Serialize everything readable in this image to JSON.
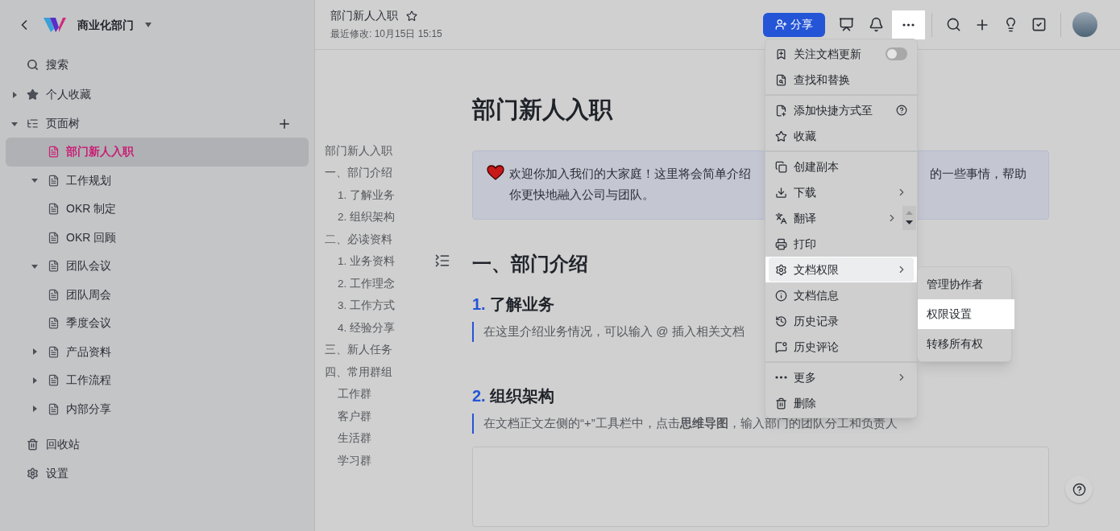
{
  "sidebar": {
    "workspace": "商业化部门",
    "nav": [
      {
        "label": "搜索"
      },
      {
        "label": "个人收藏",
        "expanded": false
      }
    ],
    "tree": {
      "label": "页面树",
      "expanded": true,
      "children": [
        {
          "label": "部门新人入职",
          "selected": true
        },
        {
          "label": "工作规划",
          "selected": false,
          "expanded": true,
          "children": [
            {
              "label": "OKR 制定",
              "selected": false
            },
            {
              "label": "OKR 回顾",
              "selected": false
            }
          ]
        },
        {
          "label": "团队会议",
          "selected": false,
          "expanded": true,
          "children": [
            {
              "label": "团队周会",
              "selected": false
            },
            {
              "label": "季度会议",
              "selected": false
            }
          ]
        },
        {
          "label": "产品资料",
          "selected": false,
          "expanded": false
        },
        {
          "label": "工作流程",
          "selected": false,
          "expanded": false
        },
        {
          "label": "内部分享",
          "selected": false,
          "expanded": false
        }
      ]
    },
    "footer": [
      {
        "label": "回收站"
      },
      {
        "label": "设置"
      }
    ]
  },
  "header": {
    "title": "部门新人入职",
    "modified": "最近修改: 10月15日 15:15",
    "share": "分享",
    "more_open": true
  },
  "outline": [
    {
      "label": "部门新人入职"
    },
    {
      "label": "一、部门介绍",
      "children": [
        {
          "label": "1. 了解业务"
        },
        {
          "label": "2. 组织架构"
        }
      ]
    },
    {
      "label": "二、必读资料",
      "children": [
        {
          "label": "1. 业务资料"
        },
        {
          "label": "2. 工作理念"
        },
        {
          "label": "3. 工作方式"
        },
        {
          "label": "4. 经验分享"
        }
      ]
    },
    {
      "label": "三、新人任务"
    },
    {
      "label": "四、常用群组",
      "children": [
        {
          "label": "工作群"
        },
        {
          "label": "客户群"
        },
        {
          "label": "生活群"
        },
        {
          "label": "学习群"
        }
      ]
    }
  ],
  "document": {
    "title": "部门新人入职",
    "callout": {
      "line_1_left": "欢迎你加入我们的大家庭！这里将会简单介绍",
      "line_1_right": "的一些事情，帮助",
      "line_2": "你更快地融入公司与团队。"
    },
    "section": "一、部门介绍",
    "subsections": [
      {
        "number": "1.",
        "title": "了解业务",
        "quote": "在这里介绍业务情况，可以输入 @ 插入相关文档"
      },
      {
        "number": "2.",
        "title": "组织架构",
        "quote": "在文档正文左侧的“+”工具栏中，点击**思维导图**，输入部门的团队分工和负责人"
      }
    ]
  },
  "menu": {
    "groups": [
      [
        {
          "label": "关注文档更新",
          "kind": "toggle",
          "on": false,
          "selected": false
        },
        {
          "label": "查找和替换",
          "kind": "plain",
          "selected": false
        }
      ],
      [
        {
          "label": "添加快捷方式至",
          "kind": "help",
          "selected": false
        },
        {
          "label": "收藏",
          "kind": "plain",
          "selected": false
        }
      ],
      [
        {
          "label": "创建副本",
          "kind": "plain",
          "selected": false
        },
        {
          "label": "下载",
          "kind": "submenu",
          "selected": false
        },
        {
          "label": "翻译",
          "kind": "submenu_stepper",
          "selected": false
        },
        {
          "label": "打印",
          "kind": "plain",
          "selected": false
        },
        {
          "label": "文档权限",
          "kind": "submenu",
          "selected": true
        },
        {
          "label": "文档信息",
          "kind": "plain",
          "selected": false
        },
        {
          "label": "历史记录",
          "kind": "plain",
          "selected": false
        },
        {
          "label": "历史评论",
          "kind": "plain",
          "selected": false
        }
      ],
      [
        {
          "label": "更多",
          "kind": "submenu",
          "selected": false
        },
        {
          "label": "删除",
          "kind": "plain",
          "selected": false
        }
      ]
    ],
    "submenu": [
      {
        "label": "管理协作者",
        "selected": false
      },
      {
        "label": "权限设置",
        "selected": true
      },
      {
        "label": "转移所有权",
        "selected": false
      }
    ]
  }
}
